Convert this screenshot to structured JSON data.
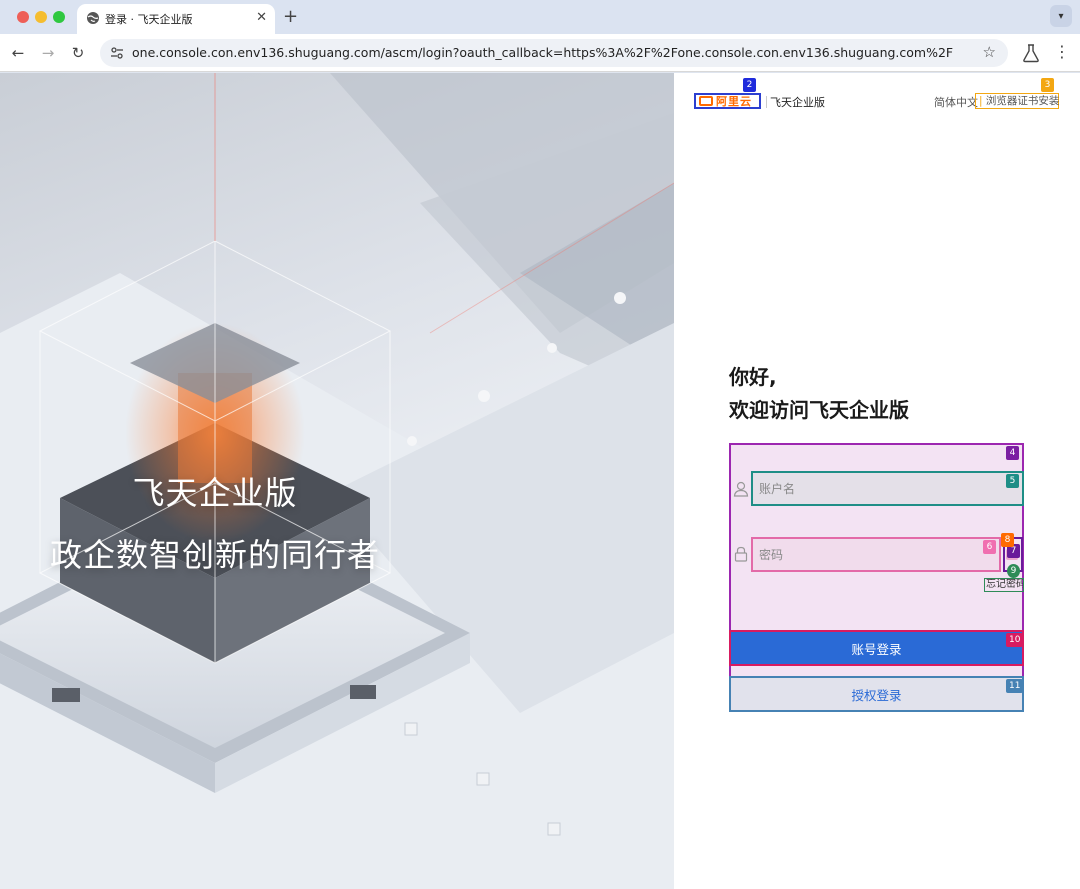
{
  "browser": {
    "tab_title": "登录 · 飞天企业版",
    "new_tab_label": "+",
    "url": "one.console.con.env136.shuguang.com/ascm/login?oauth_callback=https%3A%2F%2Fone.console.con.env136.shuguang.com%2F",
    "icons": [
      "globe-icon",
      "close-icon",
      "back-icon",
      "forward-icon",
      "reload-icon",
      "site-info-icon",
      "star-icon",
      "labs-icon",
      "more-icon",
      "chevron-down-icon"
    ]
  },
  "hero": {
    "title": "飞天企业版",
    "subtitle": "政企数智创新的同行者"
  },
  "header": {
    "logo_text": "阿里云",
    "product_name": "飞天企业版",
    "language": "简体中文",
    "cert_separator": "|",
    "cert_link": "浏览器证书安装"
  },
  "login": {
    "greeting": "你好,",
    "welcome": "欢迎访问飞天企业版",
    "username_placeholder": "账户名",
    "password_placeholder": "密码",
    "forgot_password": "忘记密码",
    "login_button": "账号登录",
    "auth_button": "授权登录"
  },
  "badges": {
    "b2": "2",
    "b3": "3",
    "b4": "4",
    "b5": "5",
    "b6": "6",
    "b7": "7",
    "b8": "8",
    "b9": "9",
    "b10": "10",
    "b11": "11"
  },
  "colors": {
    "primary": "#2a6ad6",
    "brand_orange": "#ff6a00",
    "badge_blue": "#1f2bdc",
    "badge_orange": "#f3a712",
    "badge_purple": "#7b1fa2",
    "badge_teal": "#1e8e86",
    "badge_pink": "#f06fb0",
    "badge_red": "#d81b60",
    "badge_steel": "#4682b4"
  }
}
